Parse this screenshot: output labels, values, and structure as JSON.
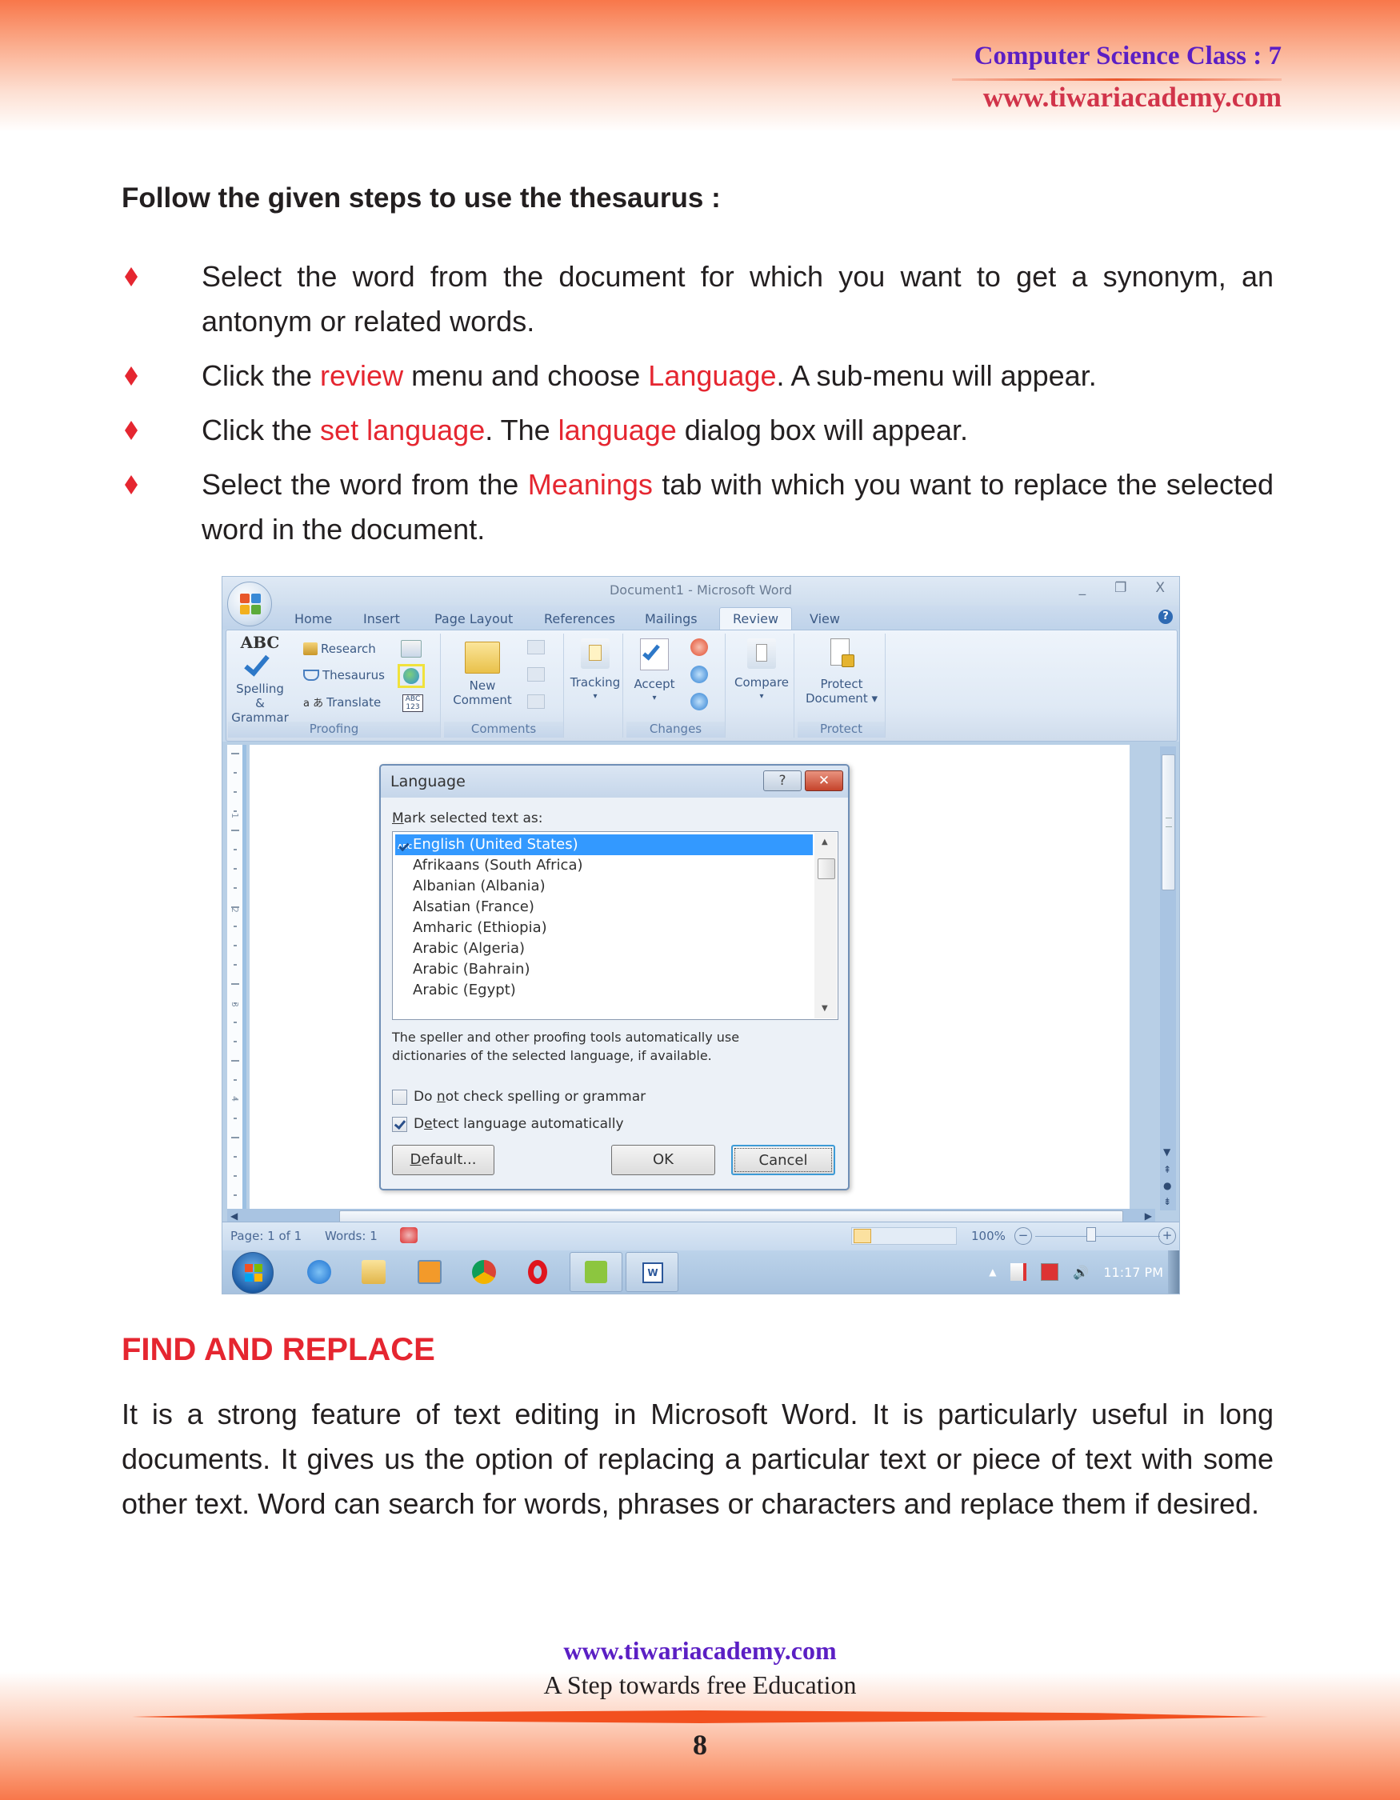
{
  "header": {
    "class_title": "Computer Science Class : 7",
    "website": "www.tiwariacademy.com"
  },
  "intro_heading": "Follow the given steps to use the thesaurus :",
  "bullets": [
    {
      "parts": [
        {
          "t": "Select the word from the document for which you want to get a synonym, an antonym or related words.",
          "hl": false
        }
      ]
    },
    {
      "parts": [
        {
          "t": "Click the ",
          "hl": false
        },
        {
          "t": "review",
          "hl": true
        },
        {
          "t": " menu and choose ",
          "hl": false
        },
        {
          "t": "Language",
          "hl": true
        },
        {
          "t": ". A sub-menu will appear.",
          "hl": false
        }
      ]
    },
    {
      "parts": [
        {
          "t": "Click the ",
          "hl": false
        },
        {
          "t": "set language",
          "hl": true
        },
        {
          "t": ". The ",
          "hl": false
        },
        {
          "t": "language",
          "hl": true
        },
        {
          "t": " dialog box will appear.",
          "hl": false
        }
      ]
    },
    {
      "parts": [
        {
          "t": "Select the word from the ",
          "hl": false
        },
        {
          "t": "Meanings",
          "hl": true
        },
        {
          "t": " tab with which you want to replace the selected word in the document.",
          "hl": false
        }
      ]
    }
  ],
  "word": {
    "window_title": "Document1 - Microsoft Word",
    "window_controls": {
      "minimize": "_",
      "restore": "❐",
      "close": "X"
    },
    "tabs": [
      "Home",
      "Insert",
      "Page Layout",
      "References",
      "Mailings",
      "Review",
      "View"
    ],
    "active_tab": "Review",
    "help": "?",
    "ribbon": {
      "proofing": {
        "label": "Proofing",
        "spelling": "Spelling &",
        "grammar": "Grammar",
        "abc": "ABC",
        "research": "Research",
        "thesaurus": "Thesaurus",
        "translate": "Translate",
        "wordcount": "ABC 123"
      },
      "comments": {
        "label": "Comments",
        "new": "New",
        "comment": "Comment"
      },
      "tracking": {
        "label": "Tracking"
      },
      "changes": {
        "label": "Changes",
        "accept": "Accept"
      },
      "compare": {
        "label": "Compare"
      },
      "protect": {
        "label": "Protect",
        "protect": "Protect",
        "document": "Document ▾"
      }
    },
    "ruler_numbers": [
      "1",
      "2",
      "3",
      "4"
    ],
    "status": {
      "page": "Page: 1 of 1",
      "words": "Words: 1",
      "zoom": "100%"
    },
    "tray": {
      "time": "11:17 PM"
    }
  },
  "dialog": {
    "title": "Language",
    "help": "?",
    "close": "✕",
    "label_prefix": "M",
    "label_rest": "ark selected text as:",
    "languages": [
      "English (United States)",
      "Afrikaans (South Africa)",
      "Albanian (Albania)",
      "Alsatian (France)",
      "Amharic (Ethiopia)",
      "Arabic (Algeria)",
      "Arabic (Bahrain)",
      "Arabic (Egypt)"
    ],
    "selected_language": "English (United States)",
    "note": "The speller and other proofing tools automatically use dictionaries of the selected language, if available.",
    "check_spelling": {
      "pre": "Do ",
      "u": "n",
      "post": "ot check spelling or grammar",
      "checked": false
    },
    "detect_language": {
      "pre": "D",
      "u": "e",
      "post": "tect language automatically",
      "checked": true
    },
    "buttons": {
      "default": "Default...",
      "ok": "OK",
      "cancel": "Cancel"
    }
  },
  "section": {
    "title": "FIND AND REPLACE",
    "paragraph": "It is a strong feature of text editing in Microsoft Word. It is particularly useful in long documents. It gives us the option of replacing a particular text or piece of text with some other text. Word can search for words, phrases or characters and replace them if desired."
  },
  "footer": {
    "website": "www.tiwariacademy.com",
    "tagline": "A Step towards free Education",
    "page_number": "8"
  },
  "colors": {
    "highlight": "#e52630",
    "header_purple": "#5b1fc4",
    "header_red": "#d1344a",
    "band_orange": "#f8774a"
  }
}
